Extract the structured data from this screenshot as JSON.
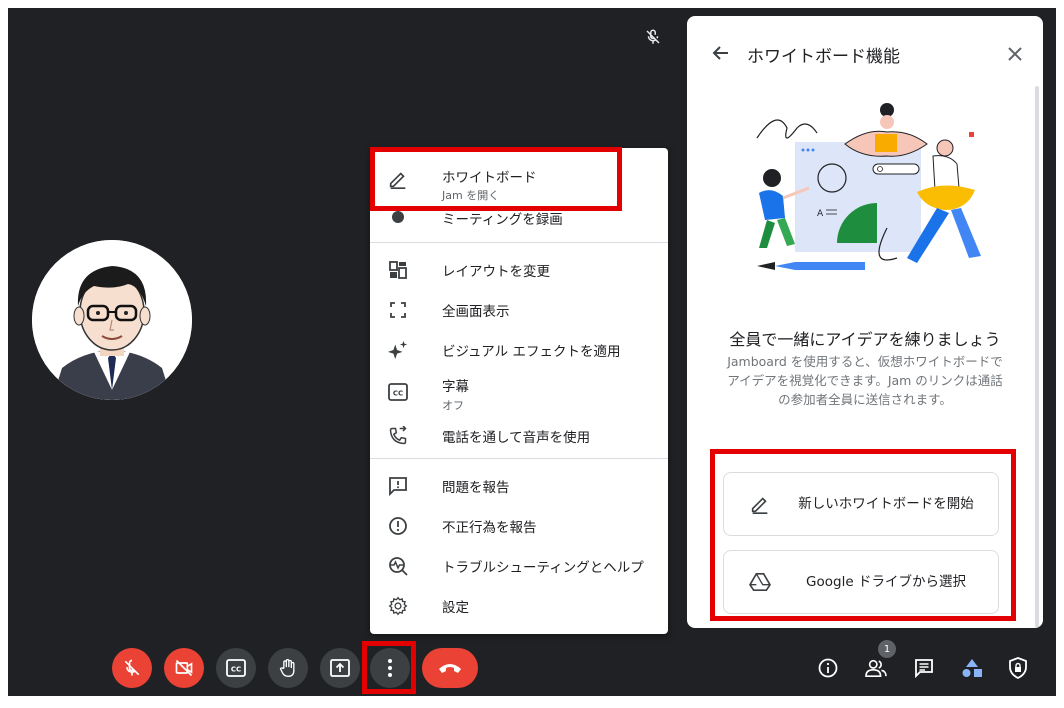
{
  "menu": {
    "whiteboard": {
      "label": "ホワイトボード",
      "sub": "Jam を開く"
    },
    "record": {
      "label": "ミーティングを録画"
    },
    "layout": {
      "label": "レイアウトを変更"
    },
    "fullscreen": {
      "label": "全画面表示"
    },
    "effects": {
      "label": "ビジュアル エフェクトを適用"
    },
    "captions": {
      "label": "字幕",
      "sub": "オフ"
    },
    "phone": {
      "label": "電話を通して音声を使用"
    },
    "report_problem": {
      "label": "問題を報告"
    },
    "report_abuse": {
      "label": "不正行為を報告"
    },
    "troubleshoot": {
      "label": "トラブルシューティングとヘルプ"
    },
    "settings": {
      "label": "設定"
    }
  },
  "panel": {
    "title": "ホワイトボード機能",
    "heading": "全員で一緒にアイデアを練りましょう",
    "description": "Jamboard を使用すると、仮想ホワイトボードでアイデアを視覚化できます。Jam のリンクは通話の参加者全員に送信されます。",
    "new_button": "新しいホワイトボードを開始",
    "drive_button": "Google ドライブから選択"
  },
  "toolbar": {
    "participants_count": "1"
  },
  "colors": {
    "accent_red": "#e30000",
    "control_red": "#ea4335",
    "control_gray": "#3c4043",
    "stage_bg": "#202124"
  }
}
